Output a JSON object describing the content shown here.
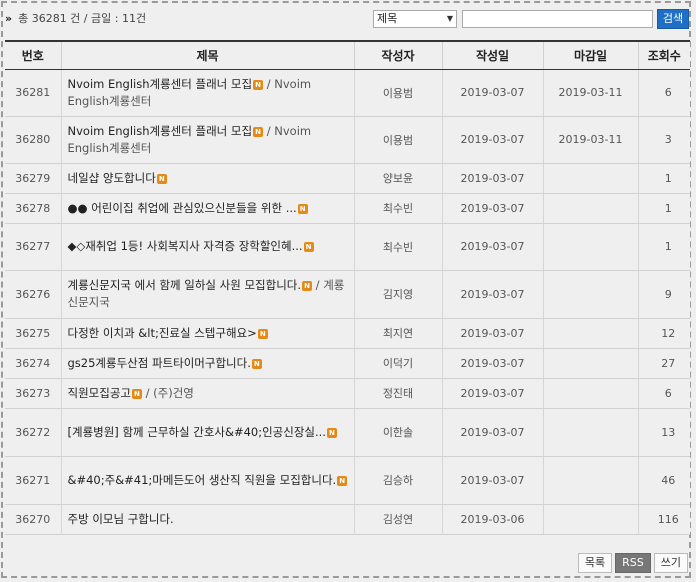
{
  "header": {
    "total_label": "총 36281 건 / 금일 : 11건",
    "search_field": "제목",
    "search_value": "",
    "search_button": "검색"
  },
  "columns": [
    "번호",
    "제목",
    "작성자",
    "작성일",
    "마감일",
    "조회수"
  ],
  "rows": [
    {
      "no": "36281",
      "title": "Nvoim English계룡센터 플래너 모집",
      "sub": " / Nvoim English계룡센터",
      "author": "이용범",
      "date": "2019-03-07",
      "deadline": "2019-03-11",
      "hits": "6"
    },
    {
      "no": "36280",
      "title": "Nvoim English계룡센터 플래너 모집",
      "sub": " / Nvoim English계룡센터",
      "author": "이용범",
      "date": "2019-03-07",
      "deadline": "2019-03-11",
      "hits": "3"
    },
    {
      "no": "36279",
      "title": "네일샵 양도합니다",
      "sub": "",
      "author": "양보윤",
      "date": "2019-03-07",
      "deadline": "",
      "hits": "1"
    },
    {
      "no": "36278",
      "title": "●● 어린이집 취업에 관심있으신분들을 위한 ...",
      "sub": "",
      "author": "최수빈",
      "date": "2019-03-07",
      "deadline": "",
      "hits": "1"
    },
    {
      "no": "36277",
      "title": "◆◇재취업 1등! 사회복지사 자격증 장학할인혜...",
      "sub": "",
      "author": "최수빈",
      "date": "2019-03-07",
      "deadline": "",
      "hits": "1"
    },
    {
      "no": "36276",
      "title": "계룡신문지국 에서 함께 일하실 사원 모집합니다.",
      "sub": " / 계룡신문지국",
      "author": "김지영",
      "date": "2019-03-07",
      "deadline": "",
      "hits": "9"
    },
    {
      "no": "36275",
      "title": "다정한 이치과 &lt;진료실 스텝구해요>",
      "sub": "",
      "author": "최지연",
      "date": "2019-03-07",
      "deadline": "",
      "hits": "12"
    },
    {
      "no": "36274",
      "title": "gs25계룡두산점 파트타이머구합니다.",
      "sub": "",
      "author": "이덕기",
      "date": "2019-03-07",
      "deadline": "",
      "hits": "27"
    },
    {
      "no": "36273",
      "title": "직원모집공고",
      "sub": " / (주)건영",
      "author": "정진태",
      "date": "2019-03-07",
      "deadline": "",
      "hits": "6"
    },
    {
      "no": "36272",
      "title": "[계룡병원] 함께 근무하실 간호사&#40;인공신장실...",
      "sub": "",
      "author": "이한솔",
      "date": "2019-03-07",
      "deadline": "",
      "hits": "13"
    },
    {
      "no": "36271",
      "title": "&#40;주&#41;마메든도어 생산직 직원을 모집합니다.",
      "sub": "",
      "author": "김승하",
      "date": "2019-03-07",
      "deadline": "",
      "hits": "46"
    },
    {
      "no": "36270",
      "title": "주방 이모님 구합니다.",
      "sub": "",
      "author": "김성연",
      "date": "2019-03-06",
      "deadline": "",
      "hits": "116"
    }
  ],
  "row_new_badge": [
    true,
    true,
    true,
    true,
    true,
    true,
    true,
    true,
    true,
    true,
    true,
    false
  ],
  "badge_text": "N",
  "footer": {
    "list_button": "목록",
    "rss_button": "RSS",
    "write_button": "쓰기"
  }
}
